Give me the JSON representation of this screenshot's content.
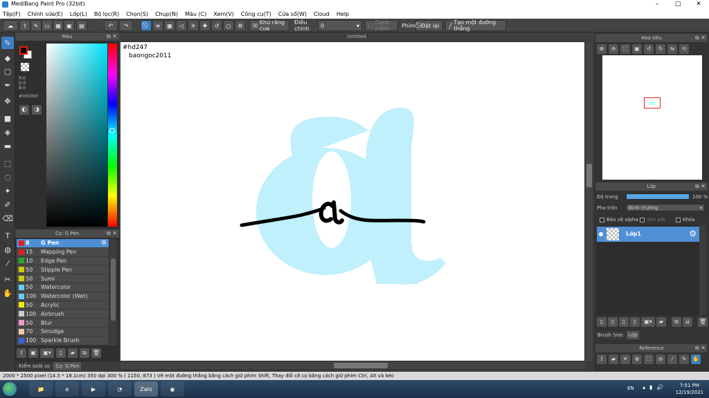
{
  "window": {
    "title": "MediBang Paint Pro (32bit)",
    "controls": [
      "–",
      "□",
      "✕"
    ]
  },
  "menu": [
    "Tệp(F)",
    "Chỉnh sửa(E)",
    "Lớp(L)",
    "Bộ lọc(R)",
    "Chọn(S)",
    "Chụp(N)",
    "Màu (C)",
    "Xem(V)",
    "Công cụ(T)",
    "Cửa sổ(W)",
    "Cloud",
    "Help"
  ],
  "toolbar": {
    "antialias_label": "Khử răng cưa",
    "adjust_label": "Điều chỉnh",
    "adjust_value": "0",
    "edge_label": "Cạnh mềm",
    "key_label": "Phím",
    "reset_label": "Đặt lại",
    "line_label": "Tạo một đường thẳng"
  },
  "color_panel": {
    "title": "Màu",
    "rgb": [
      "R:0",
      "G:0",
      "B:0"
    ],
    "hex": "#000000"
  },
  "brush_panel": {
    "title": "Cọ: G Pen",
    "items": [
      {
        "size": "8",
        "name": "G Pen",
        "color": "#d22",
        "active": true
      },
      {
        "size": "15",
        "name": "Mapping Pen",
        "color": "#d22"
      },
      {
        "size": "10",
        "name": "Edge Pen",
        "color": "#2a2"
      },
      {
        "size": "50",
        "name": "Stipple Pen",
        "color": "#cc0"
      },
      {
        "size": "50",
        "name": "Sumi",
        "color": "#cc0"
      },
      {
        "size": "50",
        "name": "Watercolor",
        "color": "#6cf"
      },
      {
        "size": "100",
        "name": "Watercolor (Wet)",
        "color": "#6cf"
      },
      {
        "size": "50",
        "name": "Acrylic",
        "color": "#ee0"
      },
      {
        "size": "100",
        "name": "Airbrush",
        "color": "#ccc"
      },
      {
        "size": "50",
        "name": "Blur",
        "color": "#e9c"
      },
      {
        "size": "70",
        "name": "Smudge",
        "color": "#eca"
      },
      {
        "size": "100",
        "name": "Sparkle Brush",
        "color": "#36d"
      }
    ]
  },
  "left_tabs": [
    "Kiểm soát cọ",
    "Cọ: G Pen"
  ],
  "document": {
    "tab": "Untitled",
    "text1": "#hd247",
    "text2": "baongoc2011"
  },
  "navigator": {
    "title": "Hoa tiêu"
  },
  "layer_panel": {
    "title": "Lớp",
    "opacity_label": "Độ trong",
    "opacity_value": "100 %",
    "opacity_fraction": 1.0,
    "blend_label": "Pha trộn",
    "blend_value": "Bình thường",
    "protect_alpha": "Bảo vệ alpha",
    "clipping": "Xén bớt",
    "lock": "Khóa",
    "layer_name": "Lớp1"
  },
  "right_tabs": [
    "Brush Size",
    "Lớp"
  ],
  "reference": {
    "title": "Reference"
  },
  "status": {
    "text": "2000 * 2500 pixel   (14.5 * 18.1cm)   350 dpi   300 %   ( 1150, 873 )   Vẽ một đường thẳng bằng cách giữ phím Shift, Thay đổi cỡ cọ bằng cách giữ phím Ctrl, Alt và kéo"
  },
  "taskbar": {
    "lang": "EN",
    "time": "7:51 PM",
    "date": "12/19/2021",
    "zalo": "Zalo"
  },
  "colors": {
    "accent": "#3c7fc0",
    "stroke_light": "#bff0fb",
    "stroke_dark": "#000000"
  }
}
